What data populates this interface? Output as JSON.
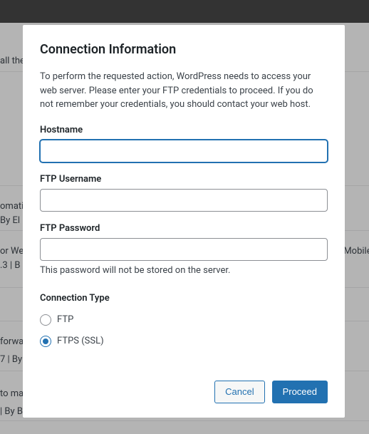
{
  "bg": {
    "snippets": [
      "all the",
      "omatic",
      "By El",
      "or We",
      ".3 | B",
      "Mobile i",
      "forwa",
      "7 | By",
      "to ma",
      "| By Backup by BlogVault"
    ]
  },
  "modal": {
    "title": "Connection Information",
    "description": "To perform the requested action, WordPress needs to access your web server. Please enter your FTP credentials to proceed. If you do not remember your credentials, you should contact your web host.",
    "hostname": {
      "label": "Hostname",
      "value": ""
    },
    "username": {
      "label": "FTP Username",
      "value": ""
    },
    "password": {
      "label": "FTP Password",
      "value": "",
      "help": "This password will not be stored on the server."
    },
    "connection_type": {
      "label": "Connection Type",
      "options": {
        "ftp": "FTP",
        "ftps": "FTPS (SSL)"
      },
      "selected": "ftps"
    },
    "buttons": {
      "cancel": "Cancel",
      "proceed": "Proceed"
    }
  }
}
